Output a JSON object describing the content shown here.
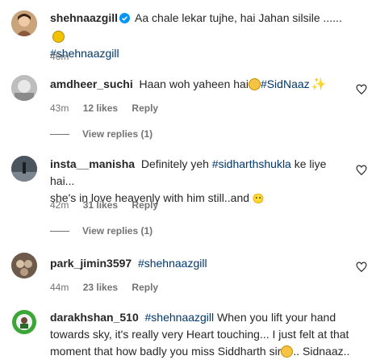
{
  "caption": {
    "username": "shehnaazgill",
    "text": "Aa chale lekar tujhe, hai Jahan silsile ......",
    "hashtag": "#shehnaazgill",
    "time": "46m"
  },
  "comments": [
    {
      "username": "amdheer_suchi",
      "text": "Haan woh yaheen hai",
      "hashtag": "#SidNaaz",
      "time": "43m",
      "likes": "12 likes",
      "reply": "Reply",
      "view_replies": "View replies (1)"
    },
    {
      "username": "insta__manisha",
      "text_before": "Definitely yeh",
      "hashtag": "#sidharthshukla",
      "text_after": "ke liye hai...",
      "line2": "she's in love heavenly with him still..and",
      "time": "42m",
      "likes": "31 likes",
      "reply": "Reply",
      "view_replies": "View replies (1)"
    },
    {
      "username": "park_jimin3597",
      "hashtag": "#shehnaazgill",
      "time": "44m",
      "likes": "23 likes",
      "reply": "Reply"
    },
    {
      "username": "darakhshan_510",
      "hashtag": "#shehnaazgill",
      "line1_text": "When you lift your hand",
      "line2": "towards sky, it's really very Heart touching... I just felt at that",
      "line3": "moment that how badly you miss Siddharth sir",
      "line3_end": ".. Sidnaaz.."
    }
  ],
  "colors": {
    "text": "#262626",
    "muted": "#737373",
    "hashtag": "#00376b",
    "verified": "#0095f6"
  }
}
